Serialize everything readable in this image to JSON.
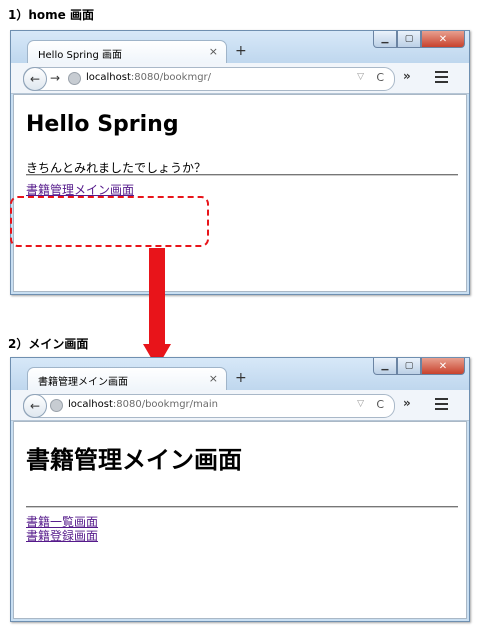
{
  "step1": {
    "caption": "1）home 画面",
    "tab_title": "Hello Spring 画面",
    "tab_close": "×",
    "new_tab": "+",
    "url_host": "localhost",
    "url_rest": ":8080/bookmgr/",
    "heading": "Hello Spring",
    "paragraph": "きちんとみれましたでしょうか？",
    "link": "書籍管理メイン画面"
  },
  "step2": {
    "caption": "2）メイン画面",
    "tab_title": "書籍管理メイン画面",
    "tab_close": "×",
    "new_tab": "+",
    "url_host": "localhost",
    "url_rest": ":8080/bookmgr/main",
    "heading": "書籍管理メイン画面",
    "links": [
      "書籍一覧画面",
      "書籍登録画面"
    ]
  },
  "window_controls": {
    "minimize": "▁",
    "maximize": "▢",
    "close": "✕"
  },
  "toolbar": {
    "overflow": "»",
    "reload": "C",
    "dropdown": "▽",
    "back": "←",
    "forward": "→"
  },
  "colors": {
    "highlight": "#e8141a",
    "visited_link": "#551a8b",
    "chrome": "#c9dff2"
  }
}
